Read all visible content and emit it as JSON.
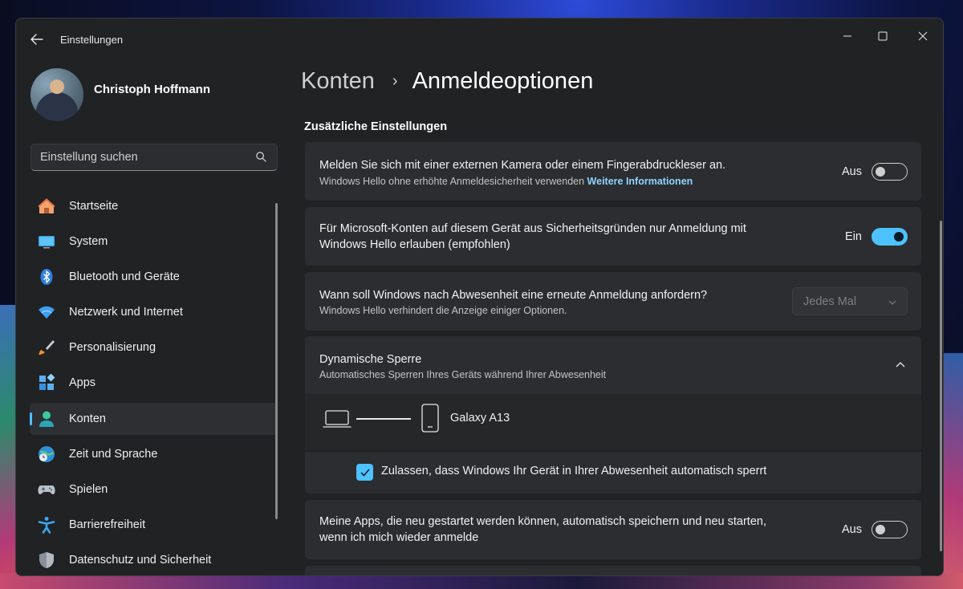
{
  "window": {
    "app_title": "Einstellungen"
  },
  "user": {
    "name": "Christoph Hoffmann"
  },
  "search": {
    "placeholder": "Einstellung suchen"
  },
  "sidebar": {
    "items": [
      {
        "label": "Startseite",
        "icon": "home-icon"
      },
      {
        "label": "System",
        "icon": "monitor-icon"
      },
      {
        "label": "Bluetooth und Geräte",
        "icon": "bluetooth-icon"
      },
      {
        "label": "Netzwerk und Internet",
        "icon": "wifi-icon"
      },
      {
        "label": "Personalisierung",
        "icon": "brush-icon"
      },
      {
        "label": "Apps",
        "icon": "apps-icon"
      },
      {
        "label": "Konten",
        "icon": "account-icon"
      },
      {
        "label": "Zeit und Sprache",
        "icon": "globe-clock-icon"
      },
      {
        "label": "Spielen",
        "icon": "gamepad-icon"
      },
      {
        "label": "Barrierefreiheit",
        "icon": "accessibility-icon"
      },
      {
        "label": "Datenschutz und Sicherheit",
        "icon": "shield-icon"
      }
    ]
  },
  "breadcrumb": {
    "parent": "Konten",
    "current": "Anmeldeoptionen"
  },
  "section": {
    "title": "Zusätzliche Einstellungen"
  },
  "settings": {
    "external_camera": {
      "title": "Melden Sie sich mit einer externen Kamera oder einem Fingerabdruckleser an.",
      "subtitle": "Windows Hello ohne erhöhte Anmeldesicherheit verwenden",
      "link": "Weitere Informationen",
      "state_label": "Aus"
    },
    "hello_only": {
      "title_line1": "Für Microsoft-Konten auf diesem Gerät aus Sicherheitsgründen nur Anmeldung mit",
      "title_line2": "Windows Hello erlauben (empfohlen)",
      "state_label": "Ein"
    },
    "require_signin": {
      "title": "Wann soll Windows nach Abwesenheit eine erneute Anmeldung anfordern?",
      "subtitle": "Windows Hello verhindert die Anzeige einiger Optionen.",
      "dropdown_value": "Jedes Mal"
    },
    "dynamic_lock": {
      "title": "Dynamische Sperre",
      "subtitle": "Automatisches Sperren Ihres Geräts während Ihrer Abwesenheit",
      "device_name": "Galaxy A13",
      "checkbox_label": "Zulassen, dass Windows Ihr Gerät in Ihrer Abwesenheit automatisch sperrt"
    },
    "restart_apps": {
      "title_line1": "Meine Apps, die neu gestartet werden können, automatisch speichern und neu starten,",
      "title_line2": "wenn ich mich wieder anmelde",
      "state_label": "Aus"
    }
  },
  "colors": {
    "accent": "#4cc2ff",
    "window_bg": "#202224",
    "card_bg": "#2b2d30"
  }
}
